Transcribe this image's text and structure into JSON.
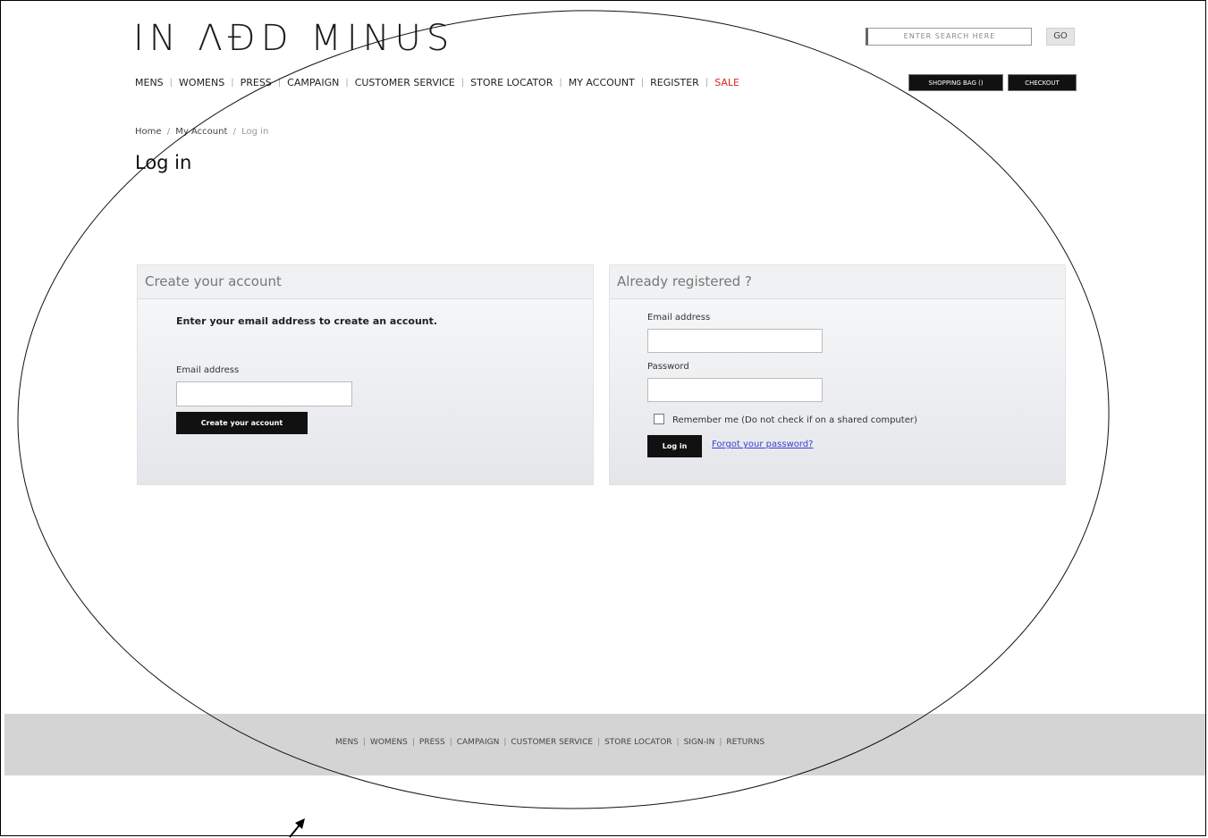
{
  "header": {
    "logo": "IN ΛÐD MINUS",
    "search_placeholder": "ENTER SEARCH HERE",
    "go_label": "GO",
    "bag_label": "SHOPPING BAG ()",
    "checkout_label": "CHECKOUT"
  },
  "nav": {
    "items": [
      "MENS",
      "WOMENS",
      "PRESS",
      "CAMPAIGN",
      "CUSTOMER SERVICE",
      "STORE LOCATOR",
      "MY ACCOUNT",
      "REGISTER",
      "SALE"
    ],
    "separator": "|"
  },
  "breadcrumb": {
    "home": "Home",
    "account": "My Account",
    "current": "Log in",
    "separator": "/"
  },
  "page": {
    "title": "Log in"
  },
  "create": {
    "heading": "Create your account",
    "intro": "Enter your email address to create an account.",
    "email_label": "Email address",
    "email_value": "",
    "button_label": "Create your account"
  },
  "login": {
    "heading": "Already registered ?",
    "email_label": "Email address",
    "email_value": "",
    "password_label": "Password",
    "password_value": "",
    "remember_label": "Remember me (Do not check if on a shared computer)",
    "remember_checked": false,
    "button_label": "Log in",
    "forgot_label": "Forgot your password?"
  },
  "footer": {
    "items": [
      "MENS",
      "WOMENS",
      "PRESS",
      "CAMPAIGN",
      "CUSTOMER SERVICE",
      "STORE LOCATOR",
      "SIGN-IN",
      "RETURNS"
    ],
    "separator": "|"
  },
  "colors": {
    "sale": "#d9281f",
    "button": "#111111",
    "footer": "#d4d4d4",
    "link": "#3a3fd0"
  }
}
